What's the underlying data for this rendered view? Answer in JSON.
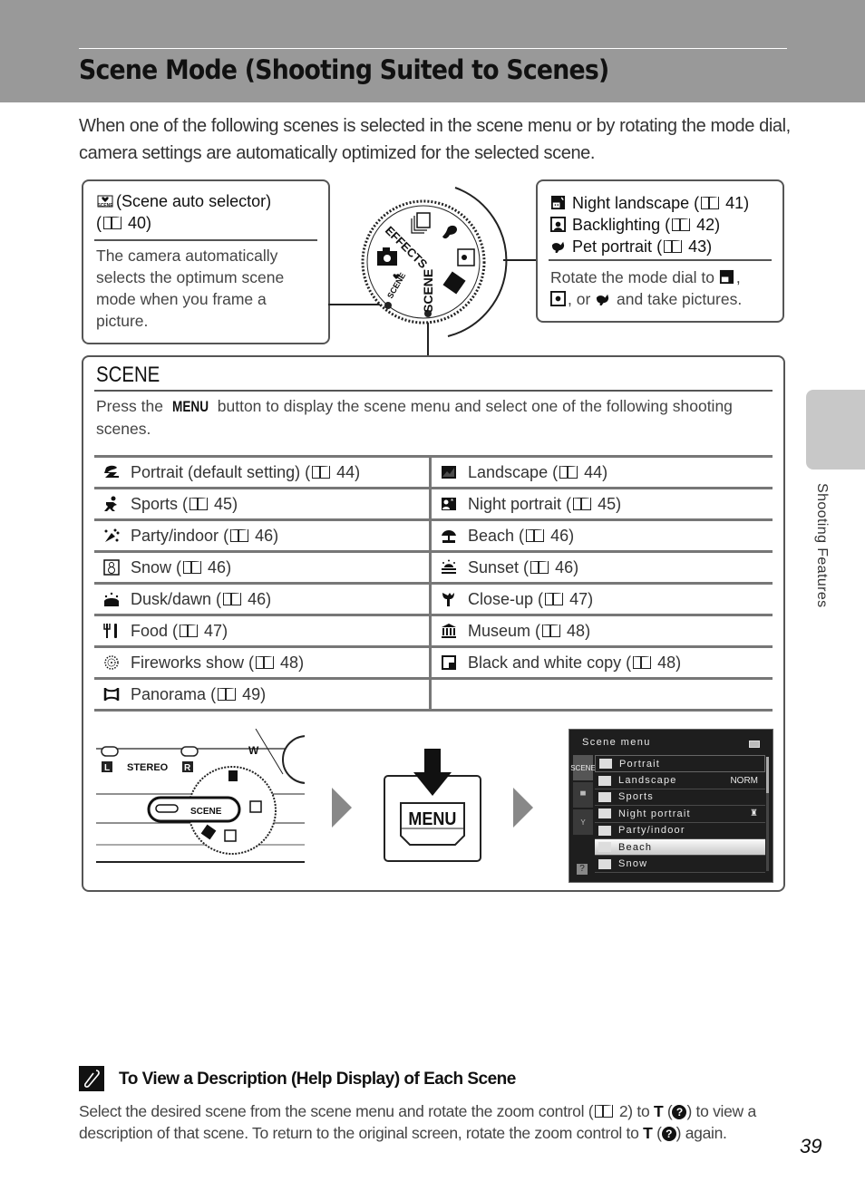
{
  "header": {
    "title": "Scene Mode (Shooting Suited to Scenes)"
  },
  "intro": "When one of the following scenes is selected in the scene menu or by rotating the mode dial, camera settings are automatically optimized for the selected scene.",
  "auto_box": {
    "icon": "scene-auto-selector-icon",
    "title": "(Scene auto selector)",
    "ref_page": "40",
    "body": "The camera automatically selects the optimum scene mode when you frame a picture."
  },
  "dial": {
    "labels": [
      "EFFECTS",
      "SCENE",
      "SCENE"
    ]
  },
  "dial_box": {
    "items": [
      {
        "icon": "night-landscape-icon",
        "label": "Night landscape",
        "ref_page": "41"
      },
      {
        "icon": "backlighting-icon",
        "label": "Backlighting",
        "ref_page": "42"
      },
      {
        "icon": "pet-portrait-icon",
        "label": "Pet portrait",
        "ref_page": "43"
      }
    ],
    "body_pre": "Rotate the mode dial to",
    "body_mid1": ",",
    "body_mid2": ", or",
    "body_post": "and take pictures."
  },
  "scene_box": {
    "title": "SCENE",
    "desc_pre": "Press the",
    "desc_button": "MENU",
    "desc_post": "button to display the scene menu and select one of the following shooting scenes.",
    "rows": [
      [
        {
          "icon": "portrait-icon",
          "label": "Portrait (default setting)",
          "ref_page": "44"
        },
        {
          "icon": "landscape-icon",
          "label": "Landscape",
          "ref_page": "44"
        }
      ],
      [
        {
          "icon": "sports-icon",
          "label": "Sports",
          "ref_page": "45"
        },
        {
          "icon": "night-portrait-icon",
          "label": "Night portrait",
          "ref_page": "45"
        }
      ],
      [
        {
          "icon": "party-indoor-icon",
          "label": "Party/indoor",
          "ref_page": "46"
        },
        {
          "icon": "beach-icon",
          "label": "Beach",
          "ref_page": "46"
        }
      ],
      [
        {
          "icon": "snow-icon",
          "label": "Snow",
          "ref_page": "46"
        },
        {
          "icon": "sunset-icon",
          "label": "Sunset",
          "ref_page": "46"
        }
      ],
      [
        {
          "icon": "dusk-dawn-icon",
          "label": "Dusk/dawn",
          "ref_page": "46"
        },
        {
          "icon": "close-up-icon",
          "label": "Close-up",
          "ref_page": "47"
        }
      ],
      [
        {
          "icon": "food-icon",
          "label": "Food",
          "ref_page": "47"
        },
        {
          "icon": "museum-icon",
          "label": "Museum",
          "ref_page": "48"
        }
      ],
      [
        {
          "icon": "fireworks-icon",
          "label": "Fireworks show",
          "ref_page": "48"
        },
        {
          "icon": "bw-copy-icon",
          "label": "Black and white copy",
          "ref_page": "48"
        }
      ],
      [
        {
          "icon": "panorama-icon",
          "label": "Panorama",
          "ref_page": "49"
        },
        null
      ]
    ]
  },
  "camera_illus": {
    "left_label": "L",
    "stereo": "STEREO",
    "right_label": "R",
    "zoom_w": "W",
    "dial_scene": "SCENE"
  },
  "menu_button": {
    "label": "MENU"
  },
  "lcd": {
    "title": "Scene menu",
    "tabs": [
      "SCENE",
      "movie",
      "setup"
    ],
    "help": "?",
    "items": [
      {
        "label": "Portrait",
        "right": ""
      },
      {
        "label": "Landscape",
        "right": "NORM"
      },
      {
        "label": "Sports",
        "right": ""
      },
      {
        "label": "Night portrait",
        "right": "tripod"
      },
      {
        "label": "Party/indoor",
        "right": ""
      },
      {
        "label": "Beach",
        "right": "",
        "selected": true
      },
      {
        "label": "Snow",
        "right": ""
      }
    ]
  },
  "tip": {
    "title": "To View a Description (Help Display) of Each Scene",
    "body_1": "Select the desired scene from the scene menu and rotate the zoom control (",
    "body_ref": "2",
    "body_2": ") to",
    "body_T1": "T",
    "body_3": "to view a description of that scene. To return to the original screen, rotate the zoom control to",
    "body_T2": "T",
    "body_4": "again."
  },
  "side_tab": {
    "label": "Shooting Features"
  },
  "page_number": "39"
}
